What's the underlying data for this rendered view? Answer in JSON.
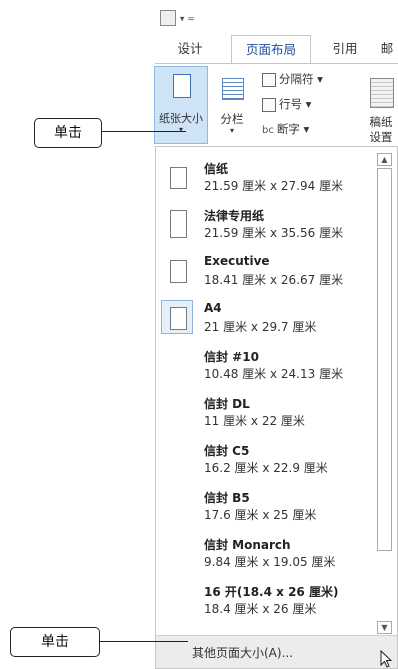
{
  "ribbon": {
    "tabs": [
      {
        "label": "设计"
      },
      {
        "label": "页面布局"
      },
      {
        "label": "引用"
      },
      {
        "label": "邮"
      }
    ],
    "size_button": {
      "label": "纸张大小",
      "caret": "▾"
    },
    "columns_button": {
      "label": "分栏",
      "caret": "▾"
    },
    "breaks": {
      "label": "分隔符 ▾"
    },
    "line_numbers": {
      "label": "行号 ▾"
    },
    "hyphenation": {
      "label": "断字 ▾",
      "prefix": "bc"
    },
    "grid_settings": {
      "line1": "稿纸",
      "line2": "设置"
    }
  },
  "paper_sizes": [
    {
      "name": "信纸",
      "dims": "21.59 厘米 x 27.94 厘米"
    },
    {
      "name": "法律专用纸",
      "dims": "21.59 厘米 x 35.56 厘米"
    },
    {
      "name": "Executive",
      "dims": "18.41 厘米 x 26.67 厘米"
    },
    {
      "name": "A4",
      "dims": "21 厘米 x 29.7 厘米"
    },
    {
      "name": "信封 #10",
      "dims": "10.48 厘米 x 24.13 厘米"
    },
    {
      "name": "信封 DL",
      "dims": "11 厘米 x 22 厘米"
    },
    {
      "name": "信封 C5",
      "dims": "16.2 厘米 x 22.9 厘米"
    },
    {
      "name": "信封 B5",
      "dims": "17.6 厘米 x 25 厘米"
    },
    {
      "name": "信封 Monarch",
      "dims": "9.84 厘米 x 19.05 厘米"
    },
    {
      "name": "16 开(18.4 x 26 厘米)",
      "dims": "18.4 厘米 x 26 厘米"
    }
  ],
  "footer": {
    "label": "其他页面大小(A)..."
  },
  "callouts": {
    "top": "单击",
    "bottom": "单击"
  },
  "colors": {
    "accent": "#1f4e9b",
    "selected_bg": "#cfe3f7"
  }
}
